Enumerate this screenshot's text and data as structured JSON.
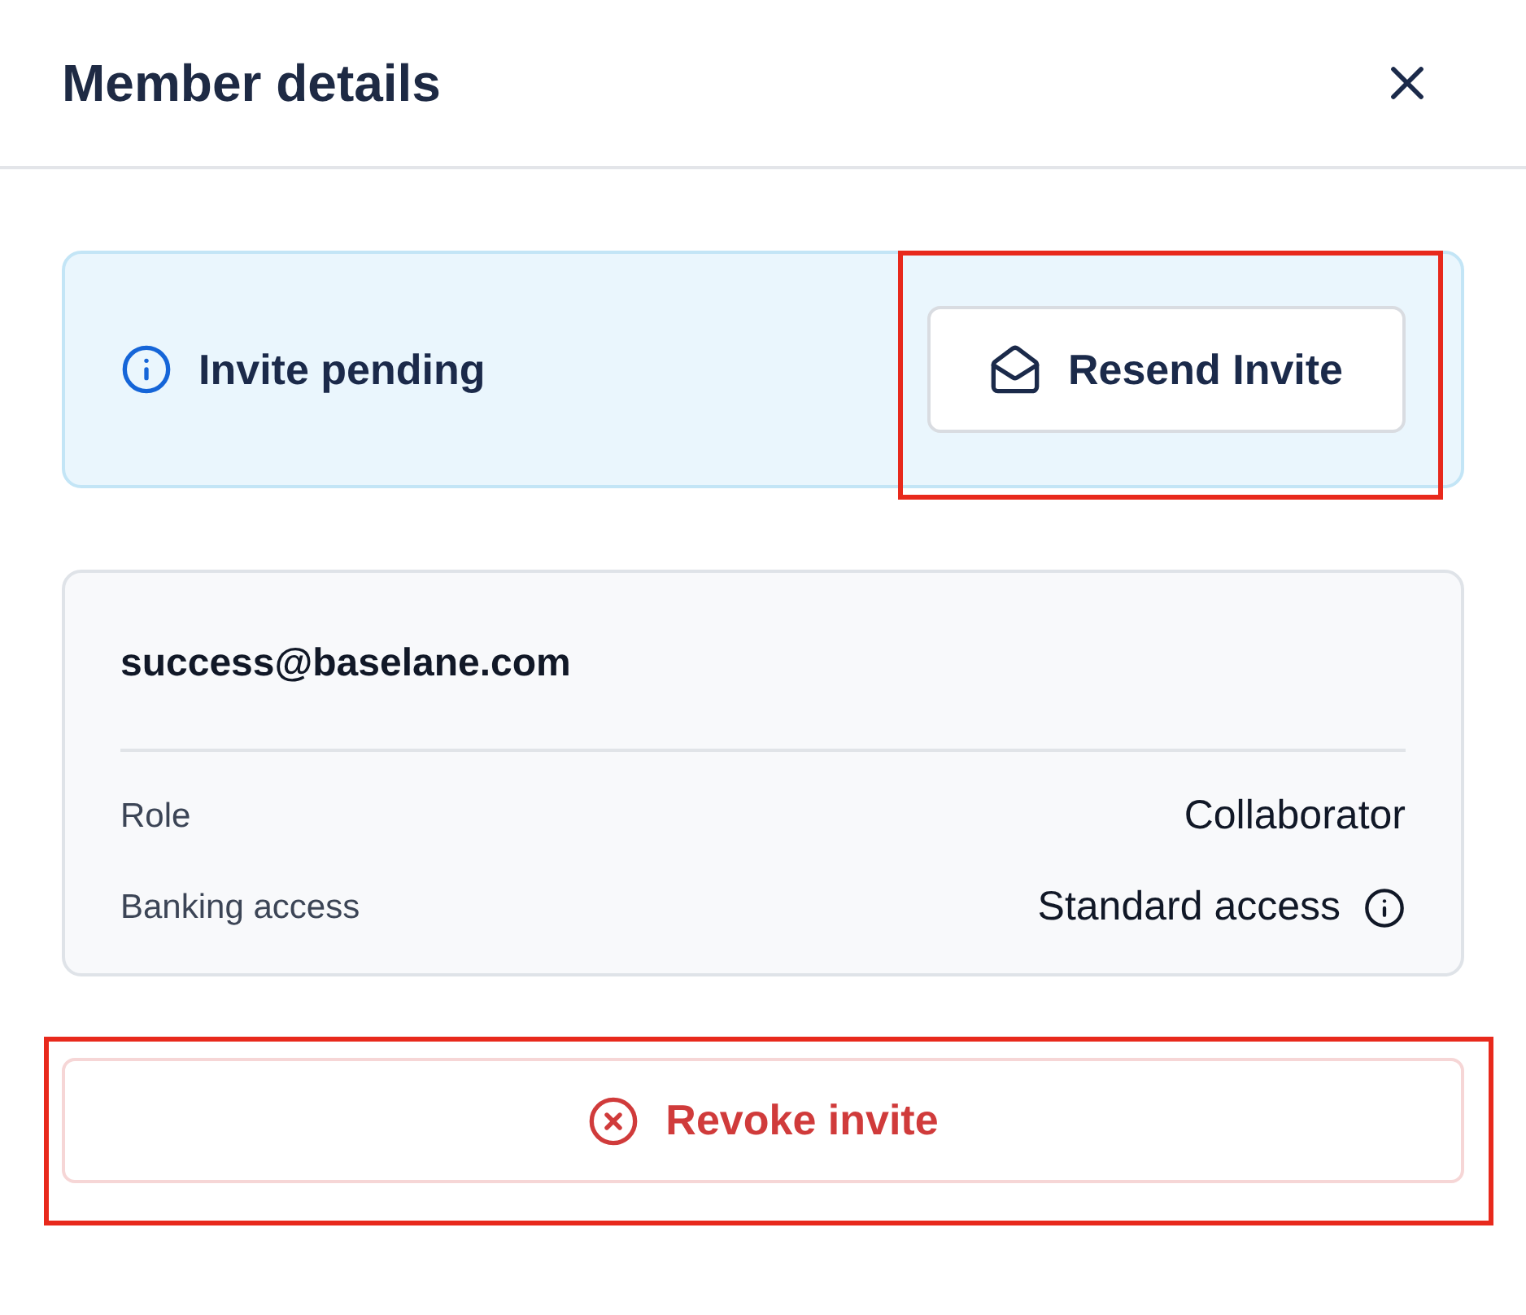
{
  "header": {
    "title": "Member details"
  },
  "invite_status": {
    "label": "Invite pending",
    "button": {
      "label": "Resend Invite",
      "highlighted": true
    }
  },
  "member": {
    "email": "success@baselane.com",
    "fields": [
      {
        "label": "Role",
        "value": "Collaborator",
        "has_info": false
      },
      {
        "label": "Banking access",
        "value": "Standard access",
        "has_info": true
      }
    ]
  },
  "revoke_button": {
    "label": "Revoke invite",
    "highlighted": true
  }
}
